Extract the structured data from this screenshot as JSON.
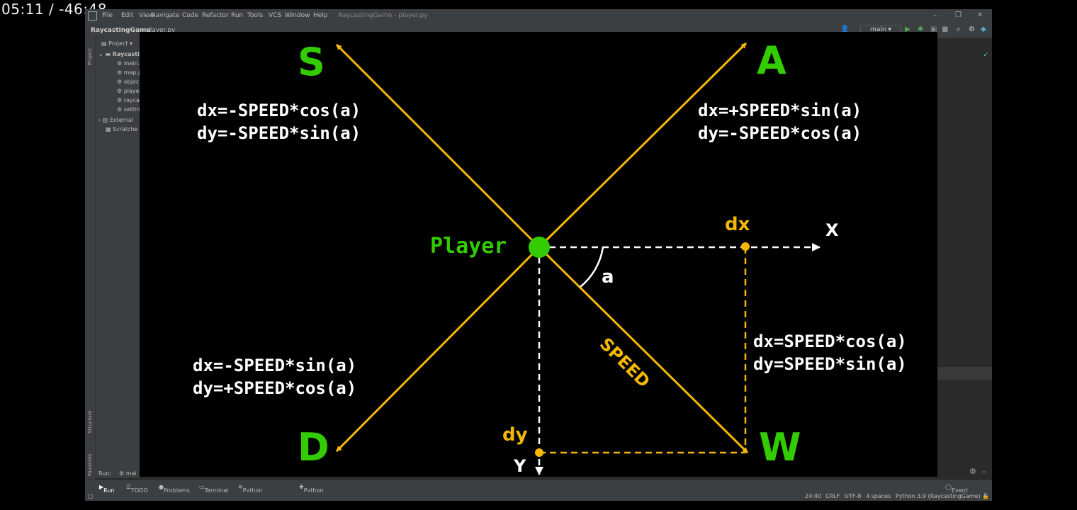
{
  "timestamp": "05:11 / -46:48",
  "menu": [
    "File",
    "Edit",
    "View",
    "Navigate",
    "Code",
    "Refactor",
    "Run",
    "Tools",
    "VCS",
    "Window",
    "Help"
  ],
  "window_title": "RaycastingGame - player.py",
  "breadcrumb": {
    "project": "RaycastingGame",
    "file": "player.py"
  },
  "branch": "main",
  "left_strip": {
    "project": "Project",
    "structure": "Structure",
    "favorites": "Favorites"
  },
  "project_panel": {
    "header": "Project",
    "root": "Raycastin",
    "files": [
      "main.",
      "map.p",
      "objec",
      "playe",
      "rayca",
      "settin"
    ],
    "external": "External",
    "scratches": "Scratche"
  },
  "run_bar": {
    "label": "Run:",
    "config": "mai"
  },
  "bottom_tabs": [
    "Run",
    "TODO",
    "Problems",
    "Terminal",
    "Python Packages",
    "Python Console"
  ],
  "event_log": "Event Log",
  "status": {
    "position": "24:40",
    "line_sep": "CRLF",
    "encoding": "UTF-8",
    "indent": "4 spaces",
    "interpreter": "Python 3.9 (RaycastingGame)"
  },
  "colors": {
    "green": "#33cc00",
    "yellow": "#f5b800",
    "white": "#ffffff",
    "ide_bg": "#2b2b2b",
    "panel_bg": "#3c3f41"
  },
  "diagram": {
    "keys": {
      "w": "W",
      "a": "A",
      "s": "S",
      "d": "D"
    },
    "formulas": {
      "s": [
        "dx=-SPEED*cos(a)",
        "dy=-SPEED*sin(a)"
      ],
      "a": [
        "dx=+SPEED*sin(a)",
        "dy=-SPEED*cos(a)"
      ],
      "d": [
        "dx=-SPEED*sin(a)",
        "dy=+SPEED*cos(a)"
      ],
      "w": [
        "dx=SPEED*cos(a)",
        "dy=SPEED*sin(a)"
      ]
    },
    "player": "Player",
    "angle": "a",
    "speed": "SPEED",
    "dx": "dx",
    "dy": "dy",
    "x_axis": "X",
    "y_axis": "Y"
  }
}
